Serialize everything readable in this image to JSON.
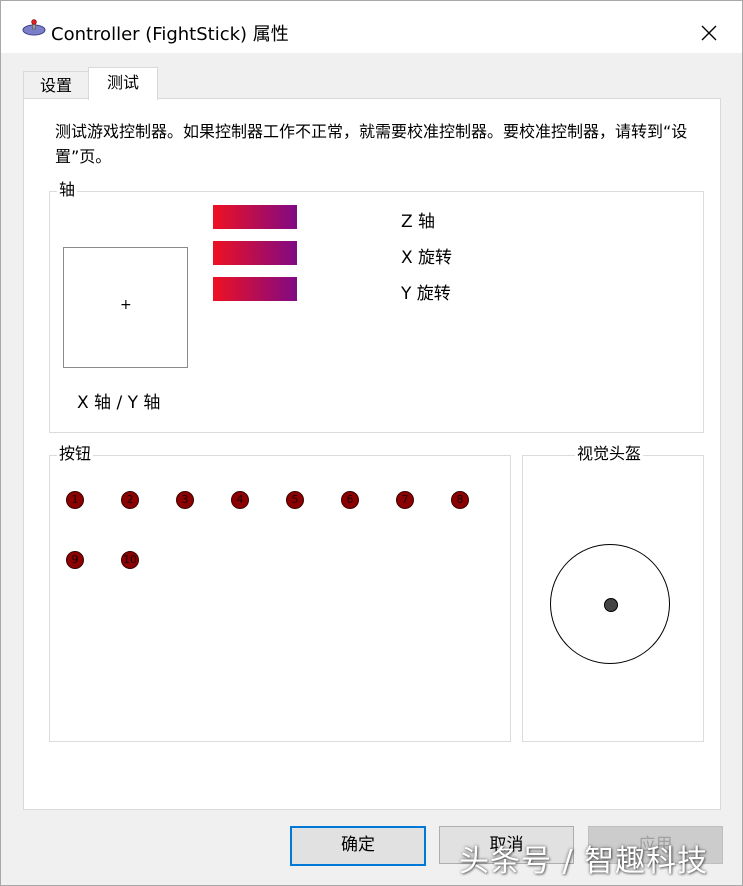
{
  "window": {
    "title": "Controller (FightStick) 属性",
    "app_icon": "joystick-icon",
    "close_icon": "close-icon"
  },
  "tabs": [
    {
      "label": "设置",
      "active": false
    },
    {
      "label": "测试",
      "active": true
    }
  ],
  "description": "测试游戏控制器。如果控制器工作不正常，就需要校准控制器。要校准控制器，请转到“设置”页。",
  "axes": {
    "group_label": "轴",
    "xy_label": "X 轴 / Y 轴",
    "xy_cursor": "+",
    "bars": [
      {
        "label": "Z 轴"
      },
      {
        "label": "X 旋转"
      },
      {
        "label": "Y 旋转"
      }
    ],
    "bar_colors": {
      "start": "#ee1122",
      "end": "#7f0a84"
    }
  },
  "buttons": {
    "group_label": "按钮",
    "items": [
      "1",
      "2",
      "3",
      "4",
      "5",
      "6",
      "7",
      "8",
      "9",
      "10"
    ],
    "color": "#8b0000"
  },
  "pov": {
    "group_label": "视觉头盔"
  },
  "dialog_buttons": {
    "ok": "确定",
    "cancel": "取消",
    "apply": "应用"
  },
  "watermark": "头条号 / 智趣科技"
}
